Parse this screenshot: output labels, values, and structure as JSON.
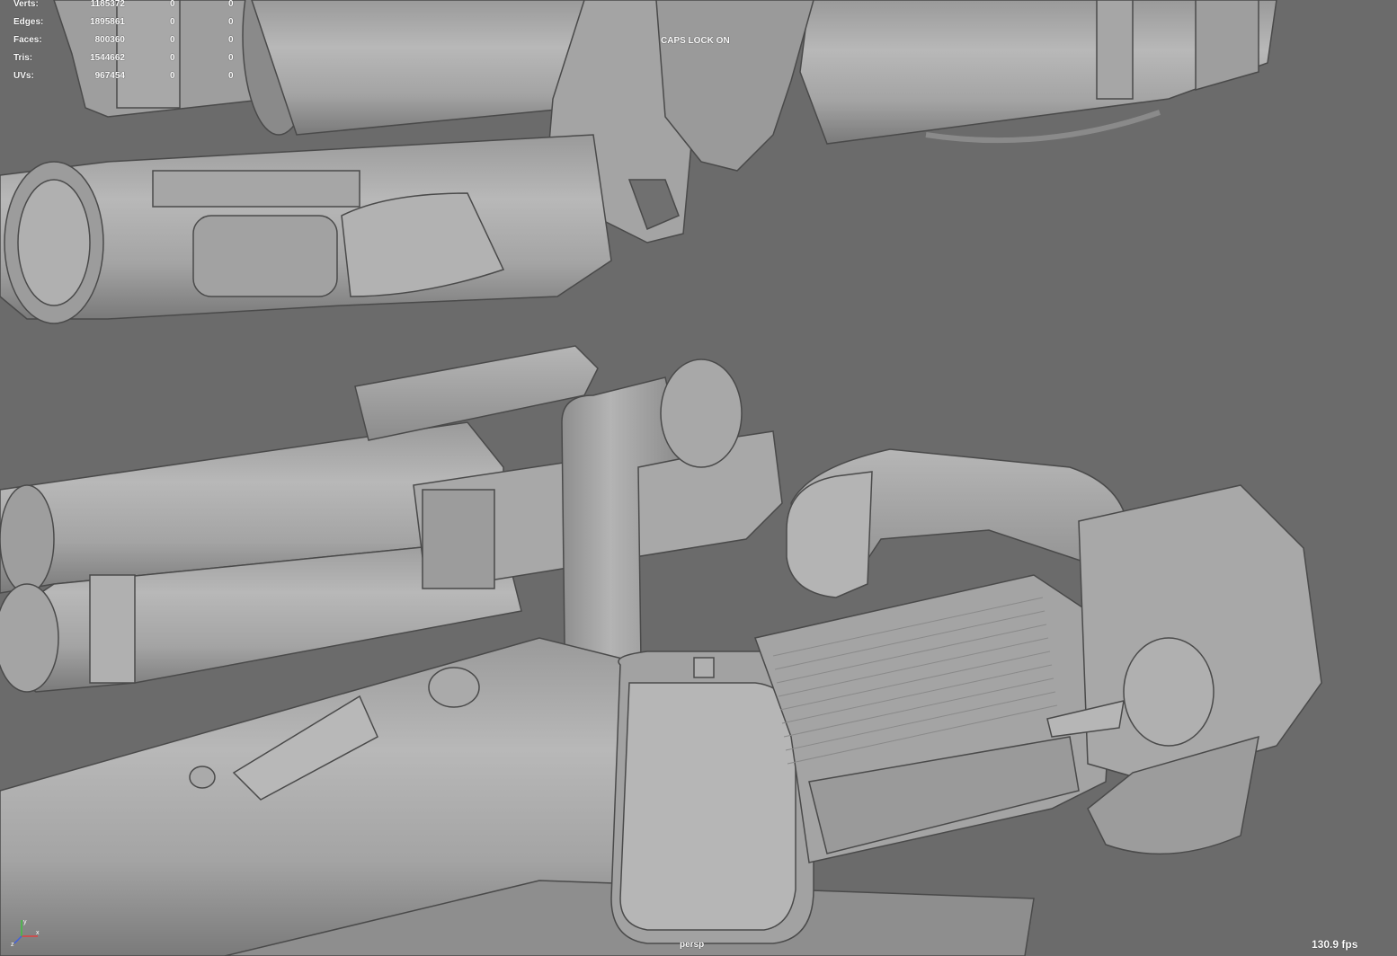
{
  "app": {
    "accent": "#6b6b6b"
  },
  "hud": {
    "stats": [
      {
        "label": "Verts:",
        "value": "1185372",
        "selected": "0",
        "component": "0"
      },
      {
        "label": "Edges:",
        "value": "1895861",
        "selected": "0",
        "component": "0"
      },
      {
        "label": "Faces:",
        "value": "800360",
        "selected": "0",
        "component": "0"
      },
      {
        "label": "Tris:",
        "value": "1544662",
        "selected": "0",
        "component": "0"
      },
      {
        "label": "UVs:",
        "value": "967454",
        "selected": "0",
        "component": "0"
      }
    ],
    "caps_lock": "CAPS LOCK ON",
    "camera": "persp",
    "fps": "130.9 fps"
  },
  "axis_gizmo": {
    "icon": "axis-gizmo-icon",
    "labels": [
      "x",
      "y",
      "z"
    ]
  }
}
